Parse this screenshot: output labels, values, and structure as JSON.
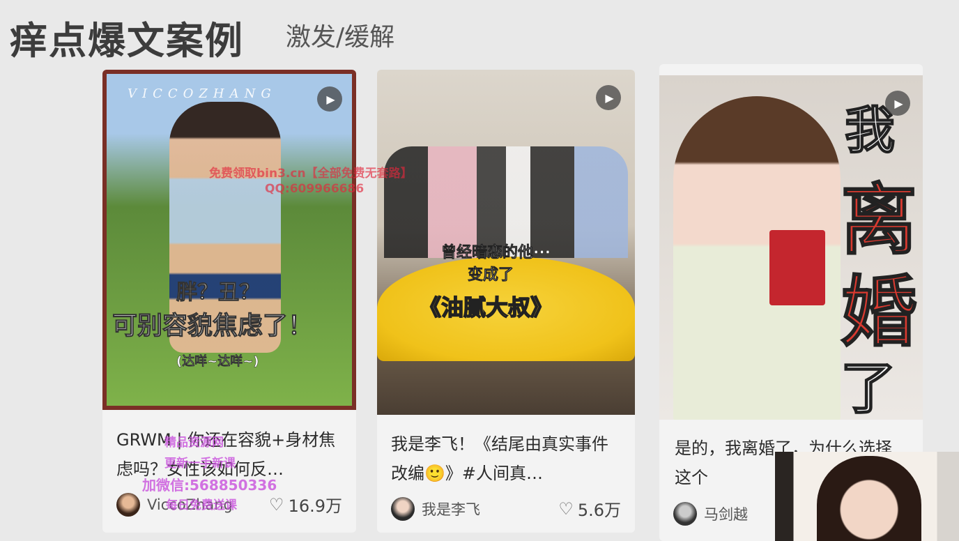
{
  "header": {
    "title": "痒点爆文案例",
    "subtitle": "激发/缓解"
  },
  "cards": [
    {
      "overlay": {
        "brand": "VICCOZHANG",
        "line1": "胖？丑？",
        "line2": "可别容貌焦虑了！",
        "line3": "(达咩~达咩~)"
      },
      "title": "GRWM | 你还在容貌+身材焦虑吗？女性该如何反…",
      "author": "ViccoZhang",
      "likes": "16.9万",
      "icon": "heart-icon"
    },
    {
      "overlay": {
        "line1": "曾经暗恋的他···",
        "line2": "变成了",
        "line3": "《油腻大叔》"
      },
      "title": "我是李飞！《结尾由真实事件改编🙂》#人间真…",
      "author": "我是李飞",
      "likes": "5.6万",
      "icon": "heart-icon"
    },
    {
      "overlay": {
        "w1": "我",
        "w2": "离",
        "w3": "婚",
        "w4": "了"
      },
      "title": "是的，我离婚了，为什么选择这个",
      "author": "马剑越"
    }
  ],
  "watermarks": {
    "w1": "免费领取bin3.cn【全部免费无套路】",
    "w2": "QQ:609966686",
    "w3": "精品资源网",
    "w4": "更新一手新课",
    "w5": "加微信:568850336",
    "w6": "每日免费送课"
  },
  "colors": {
    "background": "#e9e9e9",
    "card": "#f3f3f3",
    "accent_red": "#d93a30",
    "accent_yellow": "#f7d21e"
  }
}
